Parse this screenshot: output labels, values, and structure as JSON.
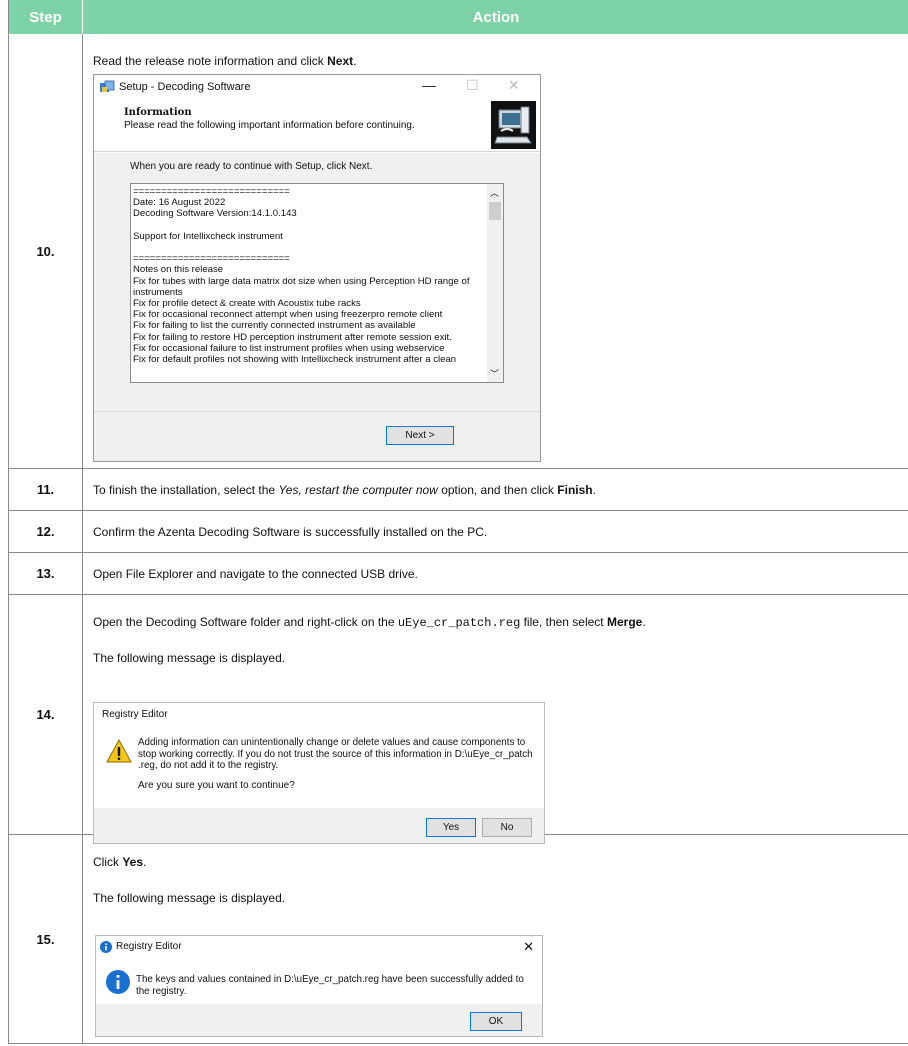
{
  "header": {
    "step": "Step",
    "action": "Action"
  },
  "rows": {
    "r10": {
      "step": "10.",
      "text_pre": "Read the release note information and click ",
      "text_bold": "Next",
      "text_post": ".",
      "setup": {
        "title": "Setup - Decoding Software",
        "info_title": "Information",
        "info_sub": "Please read the following important information before continuing.",
        "ready": "When you are ready to continue with Setup, click Next.",
        "notes": [
          "============================",
          "Date: 16 August 2022",
          "Decoding Software Version:14.1.0.143",
          "",
          "Support for Intellixcheck instrument",
          "",
          "============================",
          "Notes on this release",
          "Fix for tubes with large data matrix dot size when using Perception HD range of",
          "instruments",
          "Fix for profile detect & create with Acoustix tube racks",
          "Fix for occasional reconnect attempt when using freezerpro remote client",
          "Fix for failing to list the currently connected instrument as available",
          "Fix for failing to restore HD perception instrument after remote session exit.",
          "Fix for occasional failure to list instrument profiles when using webservice",
          "Fix for default profiles not showing with Intellixcheck instrument after a clean"
        ],
        "next_button": "Next >"
      }
    },
    "r11": {
      "step": "11.",
      "text_pre": "To finish the installation, select the ",
      "text_italic": "Yes, restart the computer now",
      "text_mid": " option, and then click ",
      "text_bold": "Finish",
      "text_post": "."
    },
    "r12": {
      "step": "12.",
      "text": "Confirm the Azenta Decoding Software is successfully installed on the PC."
    },
    "r13": {
      "step": "13.",
      "text": "Open File Explorer and navigate to the connected USB drive."
    },
    "r14": {
      "step": "14.",
      "text_pre": "Open the Decoding Software folder and right-click on the ",
      "text_mono": "uEye_cr_patch.reg",
      "text_mid": " file, then select ",
      "text_bold": "Merge",
      "text_post": ".",
      "text2": "The following message is displayed.",
      "dialog": {
        "title": "Registry Editor",
        "message": "Adding information can unintentionally change or delete values and cause components to stop working correctly. If you do not trust the source of this information in D:\\uEye_cr_patch .reg, do not add it to the registry.",
        "question": "Are you sure you want to continue?",
        "yes": "Yes",
        "no": "No"
      }
    },
    "r15": {
      "step": "15.",
      "text_pre": "Click ",
      "text_bold": "Yes",
      "text_post": ".",
      "text2": "The following message is displayed.",
      "dialog": {
        "title": "Registry Editor",
        "message": "The keys and values contained in D:\\uEye_cr_patch.reg have been successfully added to the registry.",
        "ok": "OK"
      }
    }
  }
}
